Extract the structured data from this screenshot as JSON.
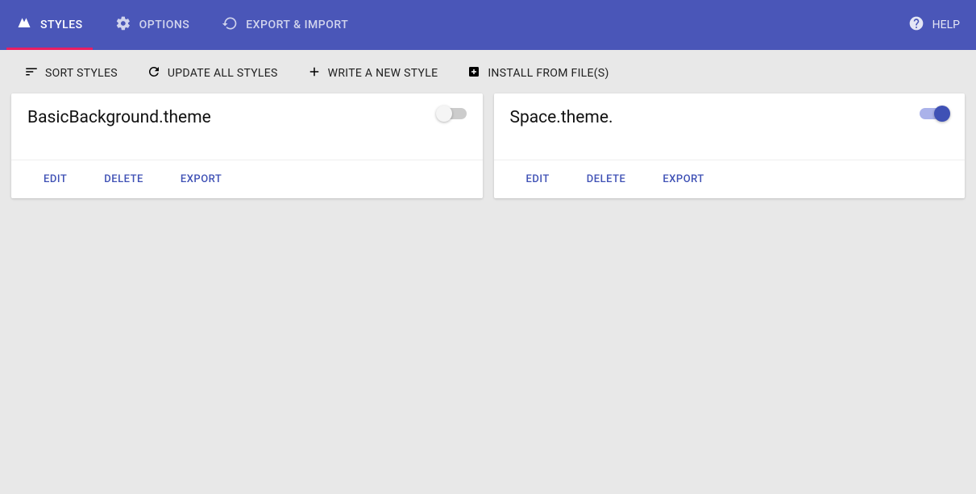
{
  "nav": {
    "styles": "STYLES",
    "options": "OPTIONS",
    "exportimport": "EXPORT & IMPORT",
    "help": "HELP"
  },
  "toolbar": {
    "sort": "SORT STYLES",
    "update": "UPDATE ALL STYLES",
    "write": "WRITE A NEW STYLE",
    "install": "INSTALL FROM FILE(S)"
  },
  "cards": [
    {
      "title": "BasicBackground.theme",
      "enabled": false
    },
    {
      "title": "Space.theme.",
      "enabled": true
    }
  ],
  "actions": {
    "edit": "EDIT",
    "delete": "DELETE",
    "export": "EXPORT"
  }
}
